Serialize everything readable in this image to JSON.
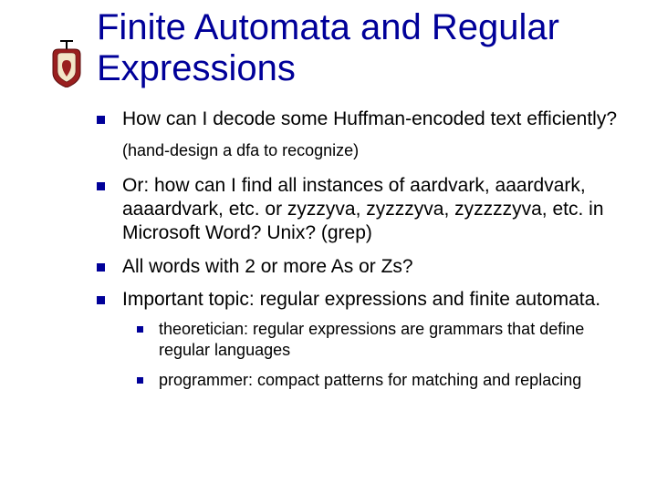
{
  "title": "Finite Automata and Regular Expressions",
  "bullets": [
    {
      "text": "How can I decode some Huffman-encoded text efficiently?"
    },
    {
      "text": "Or: how can I find all instances of aardvark, aaardvark, aaaardvark, etc. or zyzzyva, zyzzzyva, zyzzzzyva, etc. in Microsoft Word? Unix? (grep)"
    },
    {
      "text": "All words with 2 or more As or Zs?"
    },
    {
      "text": "Important topic: regular expressions and finite automata."
    }
  ],
  "note": "(hand-design a dfa to recognize)",
  "subbullets": [
    "theoretician: regular expressions are grammars that define regular languages",
    "programmer: compact patterns for matching and replacing"
  ],
  "colors": {
    "accent": "#000099"
  }
}
